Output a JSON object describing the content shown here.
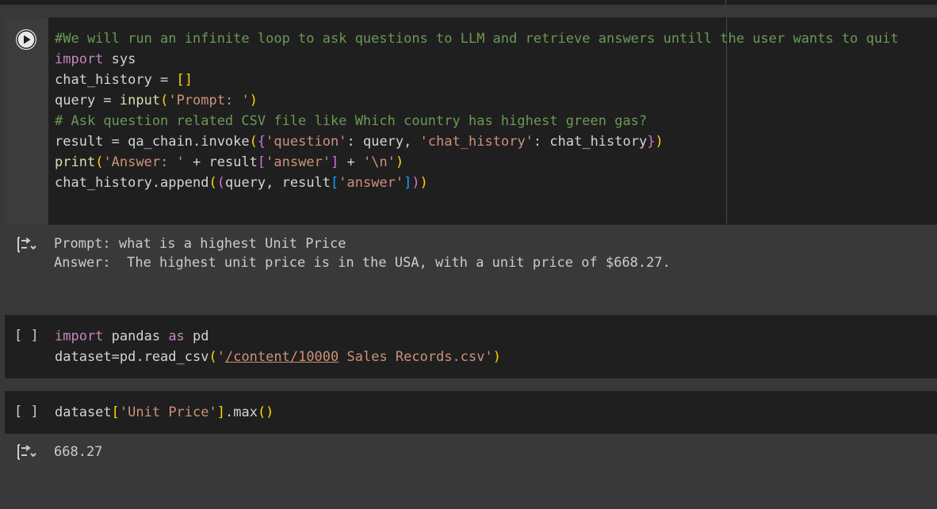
{
  "cells": {
    "cell1": {
      "lines": [
        [
          {
            "t": "#We will run an infinite loop to ask questions to LLM and retrieve answers untill the user wants to quit",
            "c": "cm"
          }
        ],
        [
          {
            "t": "import",
            "c": "kw"
          },
          {
            "t": " sys",
            "c": ""
          }
        ],
        [
          {
            "t": "chat_history = ",
            "c": ""
          },
          {
            "t": "[]",
            "c": "b1"
          }
        ],
        [
          {
            "t": "query = ",
            "c": ""
          },
          {
            "t": "input",
            "c": "fn"
          },
          {
            "t": "(",
            "c": "b1"
          },
          {
            "t": "'Prompt: '",
            "c": "str"
          },
          {
            "t": ")",
            "c": "b1"
          }
        ],
        [
          {
            "t": "# Ask question related CSV file like Which country has highest green gas?",
            "c": "cm"
          }
        ],
        [
          {
            "t": "result = qa_chain.invoke",
            "c": ""
          },
          {
            "t": "(",
            "c": "b1"
          },
          {
            "t": "{",
            "c": "b2"
          },
          {
            "t": "'question'",
            "c": "str"
          },
          {
            "t": ": query, ",
            "c": ""
          },
          {
            "t": "'chat_history'",
            "c": "str"
          },
          {
            "t": ": chat_history",
            "c": ""
          },
          {
            "t": "}",
            "c": "b2"
          },
          {
            "t": ")",
            "c": "b1"
          }
        ],
        [
          {
            "t": "print",
            "c": "fn"
          },
          {
            "t": "(",
            "c": "b1"
          },
          {
            "t": "'Answer: '",
            "c": "str"
          },
          {
            "t": " + result",
            "c": ""
          },
          {
            "t": "[",
            "c": "b2"
          },
          {
            "t": "'answer'",
            "c": "str"
          },
          {
            "t": "]",
            "c": "b2"
          },
          {
            "t": " + ",
            "c": ""
          },
          {
            "t": "'\\n'",
            "c": "str"
          },
          {
            "t": ")",
            "c": "b1"
          }
        ],
        [
          {
            "t": "chat_history.append",
            "c": ""
          },
          {
            "t": "(",
            "c": "b1"
          },
          {
            "t": "(",
            "c": "b2"
          },
          {
            "t": "query, result",
            "c": ""
          },
          {
            "t": "[",
            "c": "b3"
          },
          {
            "t": "'answer'",
            "c": "str"
          },
          {
            "t": "]",
            "c": "b3"
          },
          {
            "t": ")",
            "c": "b2"
          },
          {
            "t": ")",
            "c": "b1"
          }
        ]
      ]
    },
    "output1": {
      "lines": [
        "Prompt: what is a highest Unit Price",
        "Answer:  The highest unit price is in the USA, with a unit price of $668.27."
      ]
    },
    "cell2": {
      "bracket": "[ ]",
      "lines": [
        [
          {
            "t": "import",
            "c": "kw"
          },
          {
            "t": " pandas ",
            "c": ""
          },
          {
            "t": "as",
            "c": "kw"
          },
          {
            "t": " pd",
            "c": ""
          }
        ],
        [
          {
            "t": "dataset=pd.read_csv",
            "c": ""
          },
          {
            "t": "(",
            "c": "b1"
          },
          {
            "t": "'",
            "c": "str"
          },
          {
            "t": "/content/10000",
            "c": "str ul"
          },
          {
            "t": " Sales Records.csv'",
            "c": "str"
          },
          {
            "t": ")",
            "c": "b1"
          }
        ]
      ]
    },
    "cell3": {
      "bracket": "[ ]",
      "lines": [
        [
          {
            "t": "dataset",
            "c": ""
          },
          {
            "t": "[",
            "c": "b1"
          },
          {
            "t": "'Unit Price'",
            "c": "str"
          },
          {
            "t": "]",
            "c": "b1"
          },
          {
            "t": ".max",
            "c": ""
          },
          {
            "t": "()",
            "c": "b1"
          }
        ]
      ]
    },
    "output2": {
      "lines": [
        "668.27"
      ]
    }
  },
  "icons": {
    "run": "play-circle-icon",
    "output": "output-toggle-icon"
  },
  "colors": {
    "background": "#383838",
    "code_bg": "#1f1f1f",
    "comment": "#6a9955",
    "keyword": "#c586c0",
    "string": "#ce9178",
    "function": "#dcdcaa"
  }
}
